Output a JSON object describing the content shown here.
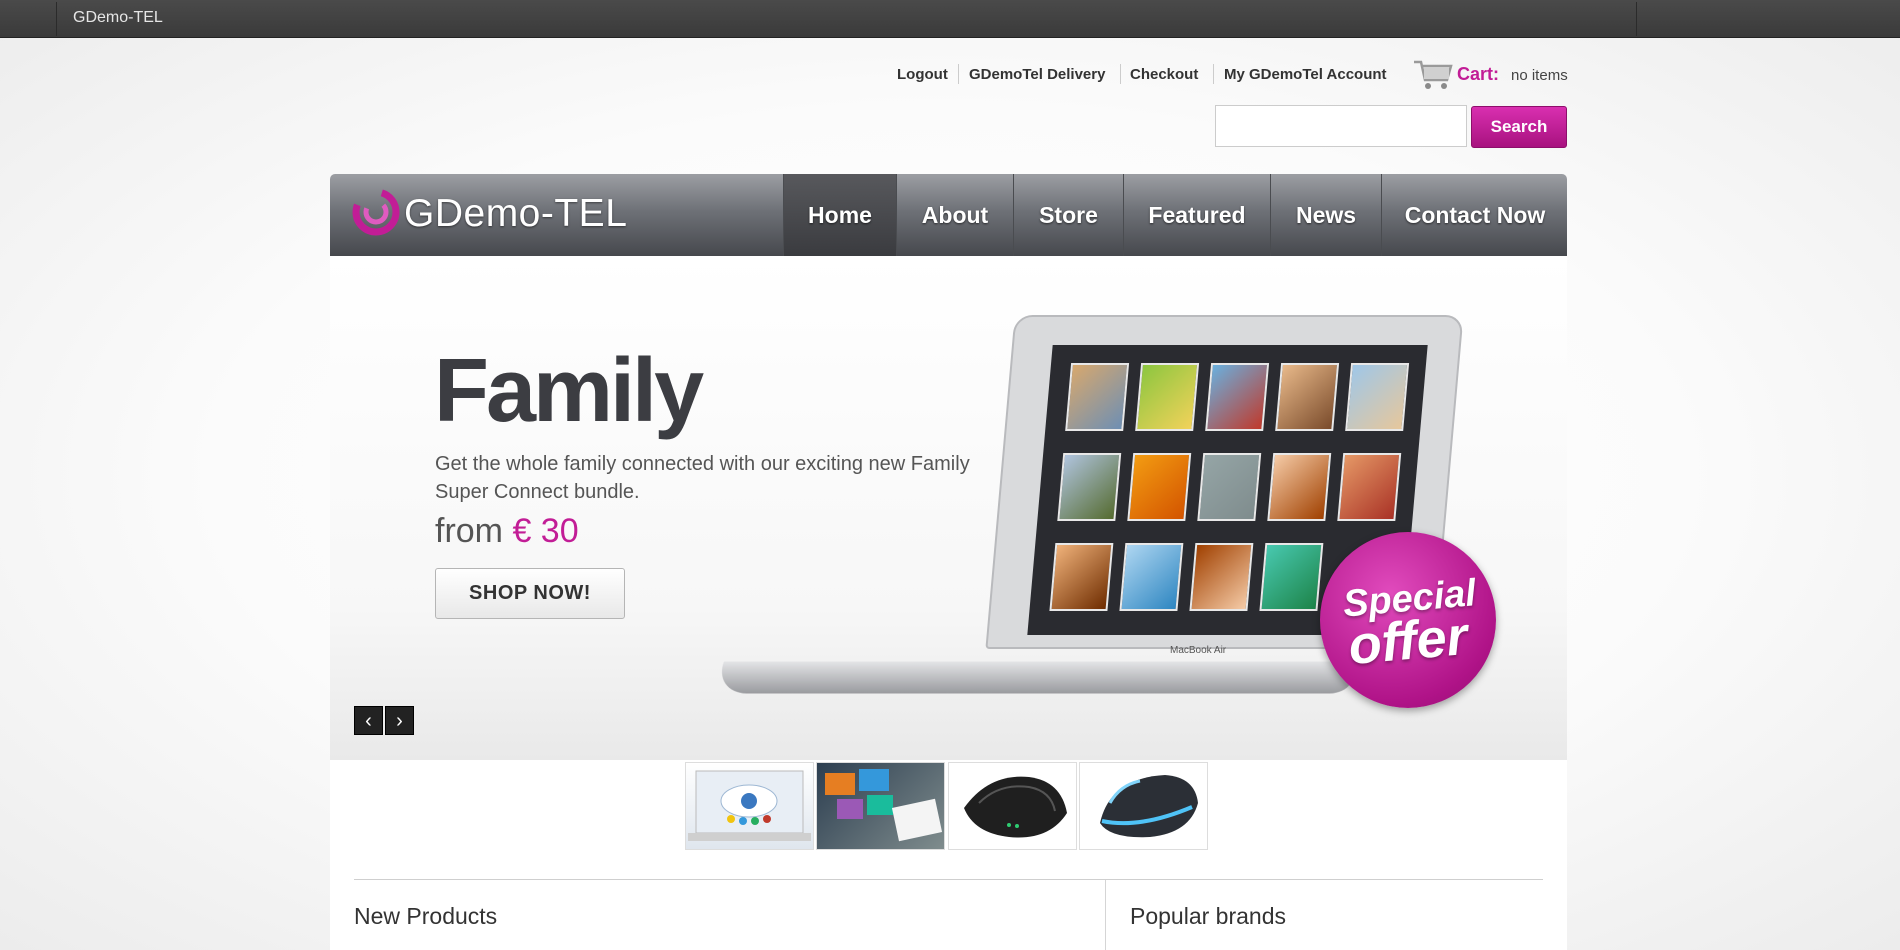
{
  "topbar": {
    "site_name": "GDemo-TEL"
  },
  "header_links": [
    {
      "label": "Logout"
    },
    {
      "label": "GDemoTel Delivery"
    },
    {
      "label": "Checkout"
    },
    {
      "label": "My GDemoTel Account"
    }
  ],
  "cart": {
    "label": "Cart:",
    "value": "no items"
  },
  "search": {
    "placeholder": "",
    "button_label": "Search"
  },
  "logo": {
    "text": "GDemo-TEL"
  },
  "nav": {
    "active": "Home",
    "items": [
      {
        "label": "Home"
      },
      {
        "label": "About"
      },
      {
        "label": "Store"
      },
      {
        "label": "Featured"
      },
      {
        "label": "News"
      },
      {
        "label": "Contact Now"
      }
    ]
  },
  "hero": {
    "title": "Family",
    "description": "Get the whole family connected with our exciting new Family Super Connect bundle.",
    "from_label": "from",
    "price": "€ 30",
    "button_label": "SHOP NOW!",
    "badge_line1": "Special",
    "badge_line2": "offer",
    "laptop_label": "MacBook Air",
    "prev_arrow": "‹",
    "next_arrow": "›"
  },
  "thumbnails": [
    {
      "name": "cloud-laptop"
    },
    {
      "name": "media-devices"
    },
    {
      "name": "black-router"
    },
    {
      "name": "blue-router"
    }
  ],
  "sections": {
    "new_products_title": "New Products",
    "popular_brands_title": "Popular brands"
  },
  "colors": {
    "accent": "#c21d96",
    "topbar": "#3f3f3f",
    "nav_dark": "#46484d"
  }
}
